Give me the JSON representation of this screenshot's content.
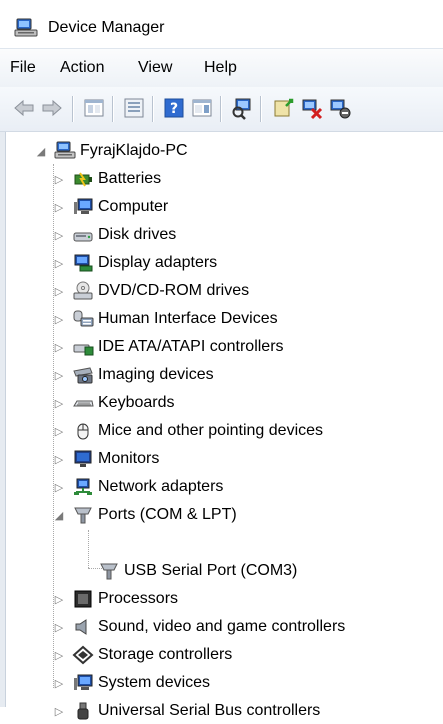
{
  "window": {
    "title": "Device Manager"
  },
  "menu": {
    "items": [
      "File",
      "Action",
      "View",
      "Help"
    ]
  },
  "toolbar": {
    "buttons": [
      "back-icon",
      "forward-icon",
      "properties-icon",
      "show-hide-console-tree-icon",
      "help-icon",
      "action-pane-icon",
      "scan-hardware-icon",
      "update-driver-icon",
      "uninstall-icon",
      "disable-icon"
    ]
  },
  "tree": {
    "root": {
      "label": "FyrajKlajdo-PC",
      "icon": "computer-icon",
      "expanded": true
    },
    "categories": [
      {
        "label": "Batteries",
        "icon": "battery-icon"
      },
      {
        "label": "Computer",
        "icon": "computer-monitor-icon"
      },
      {
        "label": "Disk drives",
        "icon": "disk-drive-icon"
      },
      {
        "label": "Display adapters",
        "icon": "display-adapter-icon"
      },
      {
        "label": "DVD/CD-ROM drives",
        "icon": "dvd-drive-icon"
      },
      {
        "label": "Human Interface Devices",
        "icon": "hid-icon"
      },
      {
        "label": "IDE ATA/ATAPI controllers",
        "icon": "ide-controller-icon"
      },
      {
        "label": "Imaging devices",
        "icon": "camera-icon"
      },
      {
        "label": "Keyboards",
        "icon": "keyboard-icon"
      },
      {
        "label": "Mice and other pointing devices",
        "icon": "mouse-icon"
      },
      {
        "label": "Monitors",
        "icon": "monitor-icon"
      },
      {
        "label": "Network adapters",
        "icon": "network-adapter-icon"
      },
      {
        "label": "Ports (COM & LPT)",
        "icon": "port-icon",
        "expanded": true,
        "children": [
          {
            "label": "USB Serial Port (COM3)",
            "icon": "port-icon"
          }
        ]
      },
      {
        "label": "Processors",
        "icon": "processor-icon"
      },
      {
        "label": "Sound, video and game controllers",
        "icon": "speaker-icon"
      },
      {
        "label": "Storage controllers",
        "icon": "storage-controller-icon"
      },
      {
        "label": "System devices",
        "icon": "system-devices-icon"
      },
      {
        "label": "Universal Serial Bus controllers",
        "icon": "usb-icon"
      }
    ]
  },
  "colors": {
    "accent": "#1e64b4",
    "menubar": "#eef2f7",
    "toolbar": "#e9eef5"
  }
}
